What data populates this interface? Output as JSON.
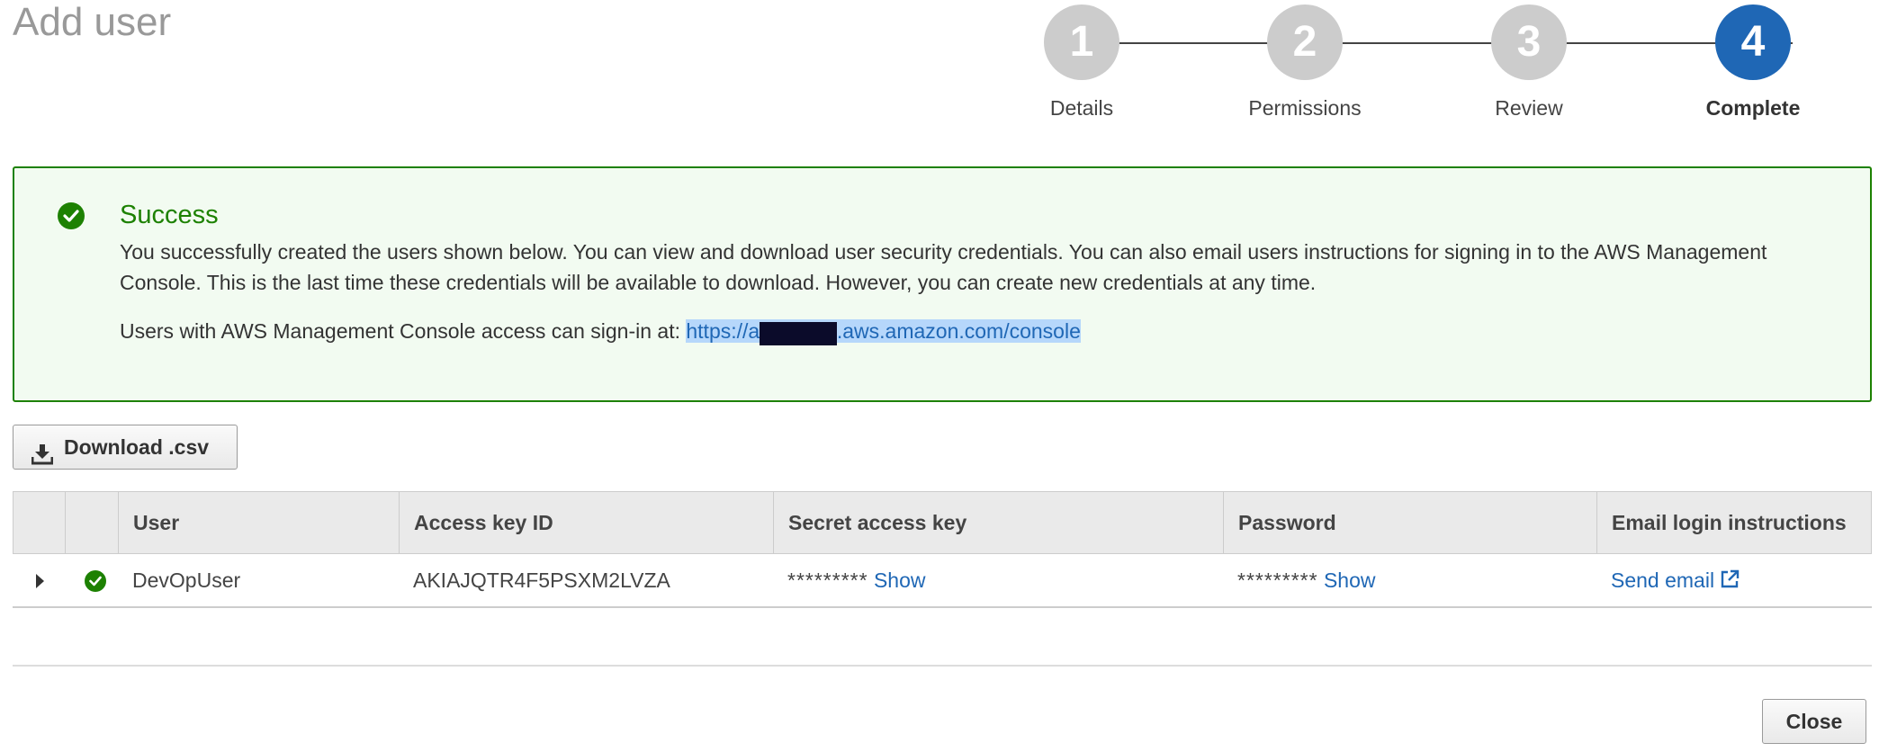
{
  "page": {
    "title": "Add user"
  },
  "stepper": {
    "steps": [
      {
        "number": "1",
        "label": "Details",
        "state": "done"
      },
      {
        "number": "2",
        "label": "Permissions",
        "state": "done"
      },
      {
        "number": "3",
        "label": "Review",
        "state": "done"
      },
      {
        "number": "4",
        "label": "Complete",
        "state": "active"
      }
    ],
    "inactive_color": "#cccccc",
    "active_color": "#1f67b5"
  },
  "success": {
    "icon": "check-circle-icon",
    "title": "Success",
    "message": "You successfully created the users shown below. You can view and download user security credentials. You can also email users instructions for signing in to the AWS Management Console. This is the last time these credentials will be available to download. However, you can create new credentials at any time.",
    "signin_prefix": "Users with AWS Management Console access can sign-in at:",
    "signin_url": "https://a        n.signin.aws.amazon.com/console",
    "signin_url_redacted": true,
    "color": "#1d8102"
  },
  "toolbar": {
    "download_label": "Download .csv",
    "download_icon": "download-icon"
  },
  "table": {
    "columns": [
      "",
      "",
      "User",
      "Access key ID",
      "Secret access key",
      "Password",
      "Email login instructions"
    ],
    "rows": [
      {
        "expander_icon": "caret-right-icon",
        "status_icon": "check-circle-icon",
        "user": "DevOpUser",
        "access_key_id": "AKIAJQTR4F5PSXM2LVZA",
        "secret_mask": "*********",
        "secret_action": "Show",
        "password_mask": "*********",
        "password_action": "Show",
        "email_action": "Send email",
        "email_icon": "external-link-icon"
      }
    ]
  },
  "footer": {
    "close_label": "Close"
  }
}
